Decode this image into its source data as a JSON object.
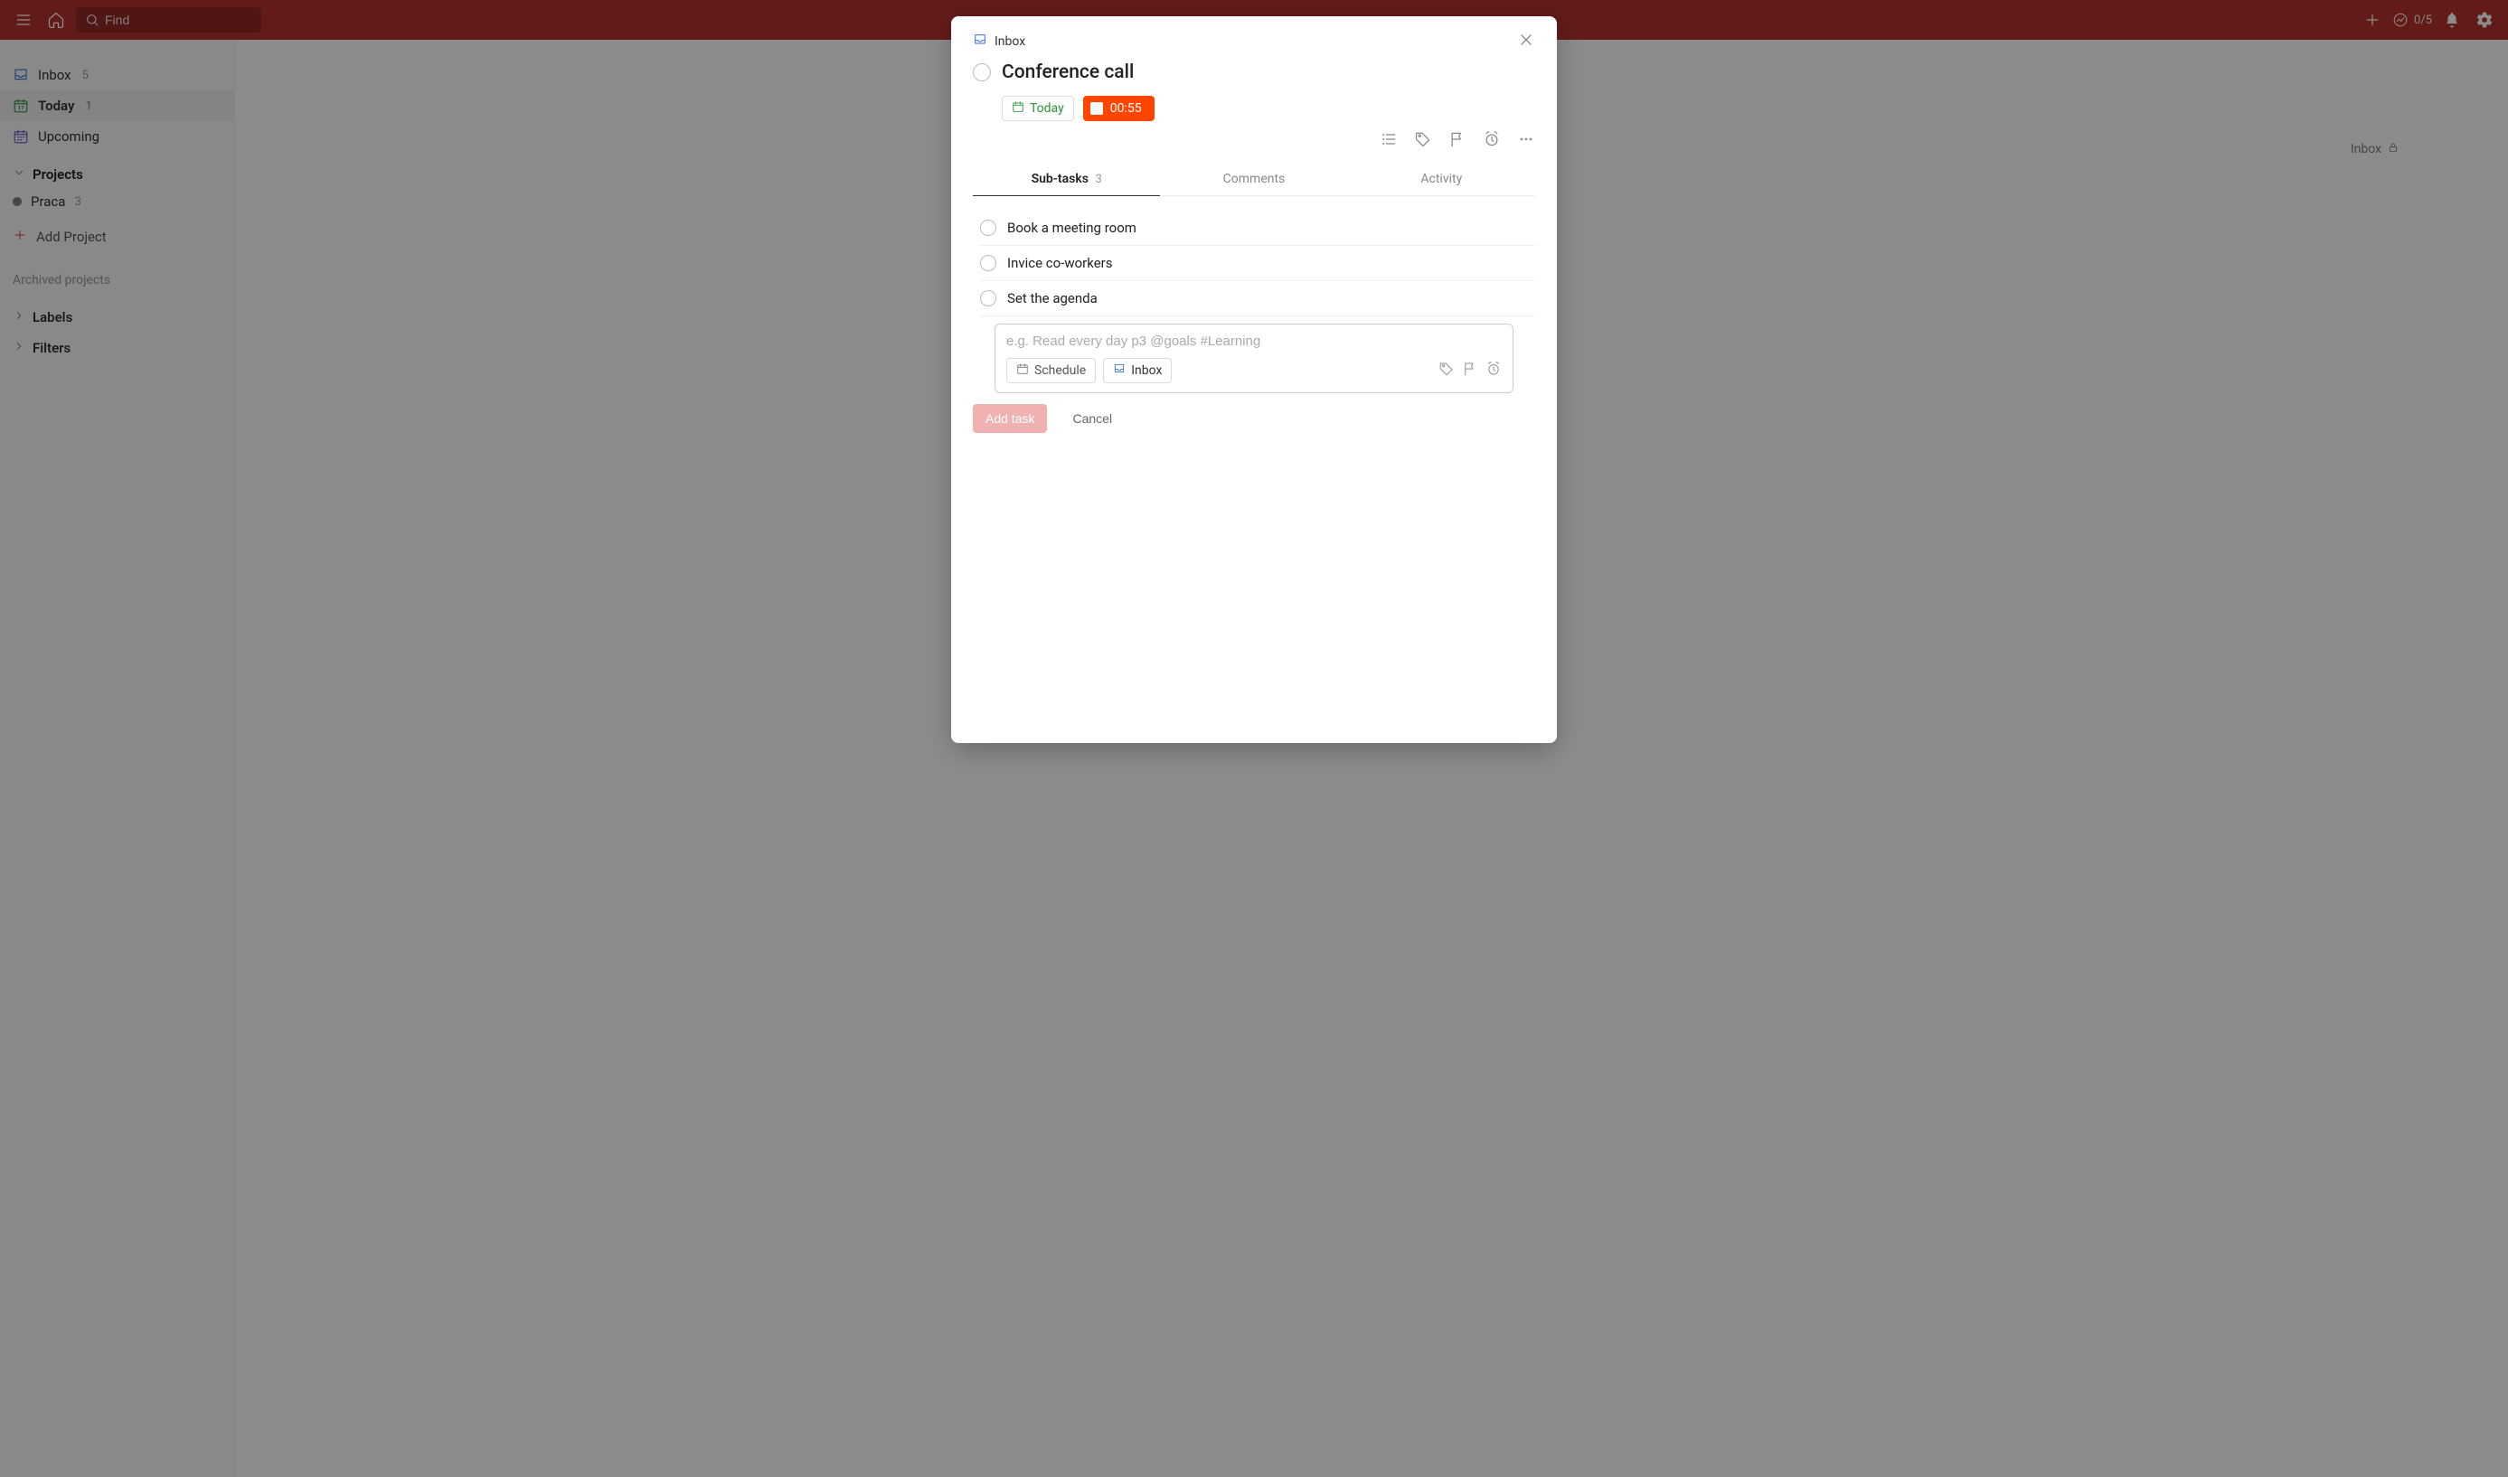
{
  "topbar": {
    "search_placeholder": "Find",
    "productivity_text": "0/5"
  },
  "sidebar": {
    "inbox_label": "Inbox",
    "inbox_count": "5",
    "today_label": "Today",
    "today_count": "1",
    "upcoming_label": "Upcoming",
    "projects_header": "Projects",
    "projects": [
      {
        "name": "Praca",
        "count": "3"
      }
    ],
    "add_project_label": "Add Project",
    "archived_label": "Archived projects",
    "labels_header": "Labels",
    "filters_header": "Filters"
  },
  "main": {
    "project_label": "Inbox"
  },
  "modal": {
    "breadcrumb": "Inbox",
    "title": "Conference call",
    "due_label": "Today",
    "timer_text": "00:55",
    "tabs": {
      "subtasks_label": "Sub-tasks",
      "subtasks_count": "3",
      "comments_label": "Comments",
      "activity_label": "Activity"
    },
    "subtasks": [
      "Book a meeting room",
      "Invice co-workers",
      "Set the agenda"
    ],
    "editor": {
      "placeholder": "e.g. Read every day p3 @goals #Learning",
      "schedule_label": "Schedule",
      "project_label": "Inbox",
      "add_task_label": "Add task",
      "cancel_label": "Cancel"
    }
  },
  "colors": {
    "brand_red": "#b4322f",
    "accent_orange": "#ff4500",
    "green": "#299438",
    "inbox_blue": "#3b6fd6",
    "upcoming_purple": "#6b4fc4"
  }
}
